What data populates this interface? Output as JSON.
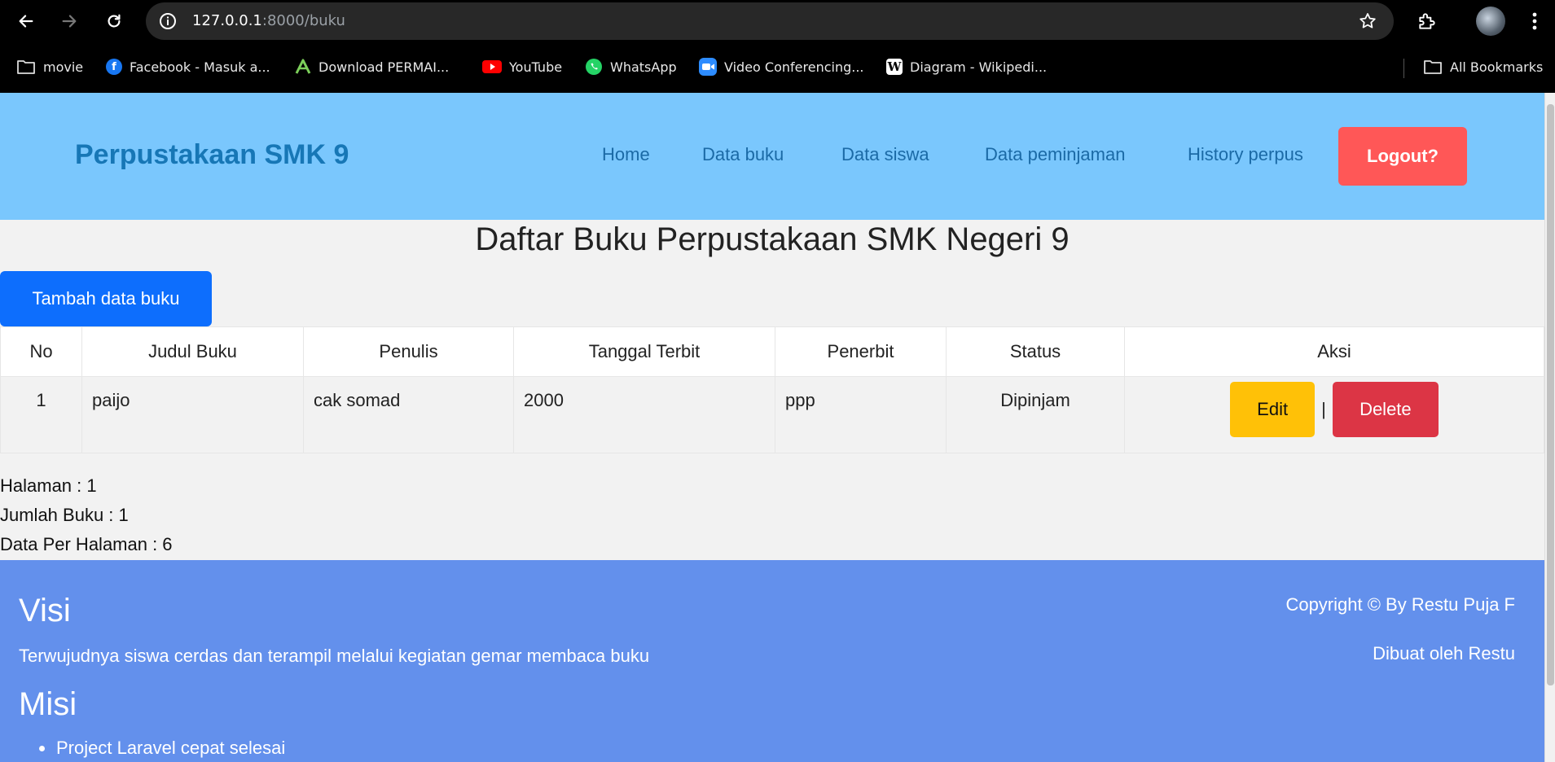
{
  "browser": {
    "url_host": "127.0.0.1",
    "url_rest": ":8000/buku",
    "bookmarks": [
      {
        "label": "movie",
        "icon": "folder-icon"
      },
      {
        "label": "Facebook - Masuk a...",
        "icon": "facebook-icon"
      },
      {
        "label": "Download PERMAI...",
        "icon": "permai-icon"
      },
      {
        "label": "YouTube",
        "icon": "youtube-icon"
      },
      {
        "label": "WhatsApp",
        "icon": "whatsapp-icon"
      },
      {
        "label": "Video Conferencing...",
        "icon": "zoom-icon"
      },
      {
        "label": "Diagram - Wikipedi...",
        "icon": "wikipedia-icon"
      }
    ],
    "all_bookmarks": "All Bookmarks"
  },
  "nav": {
    "brand": "Perpustakaan SMK 9",
    "links": [
      "Home",
      "Data buku",
      "Data siswa",
      "Data peminjaman",
      "History perpus"
    ],
    "logout": "Logout?"
  },
  "main": {
    "title": "Daftar Buku Perpustakaan SMK Negeri 9",
    "add_button": "Tambah data buku",
    "table": {
      "headers": [
        "No",
        "Judul Buku",
        "Penulis",
        "Tanggal Terbit",
        "Penerbit",
        "Status",
        "Aksi"
      ],
      "rows": [
        {
          "no": "1",
          "judul": "paijo",
          "penulis": "cak somad",
          "tanggal": "2000",
          "penerbit": "ppp",
          "status": "Dipinjam"
        }
      ],
      "edit_label": "Edit",
      "separator": "|",
      "delete_label": "Delete"
    },
    "info": {
      "halaman": "Halaman : 1",
      "jumlah": "Jumlah Buku : 1",
      "per_halaman": "Data Per Halaman : 6"
    }
  },
  "footer": {
    "visi_title": "Visi",
    "visi_text": "Terwujudnya siswa cerdas dan terampil melalui kegiatan gemar membaca buku",
    "misi_title": "Misi",
    "misi_items": [
      "Project Laravel cepat selesai"
    ],
    "copyright": "Copyright © By Restu Puja F",
    "credit": "Dibuat oleh Restu"
  },
  "colors": {
    "navbar": "#7ac7fd",
    "logout": "#ff5757",
    "primary": "#0d6efd",
    "edit": "#ffc107",
    "delete": "#dc3545",
    "footer": "#6390ec"
  }
}
